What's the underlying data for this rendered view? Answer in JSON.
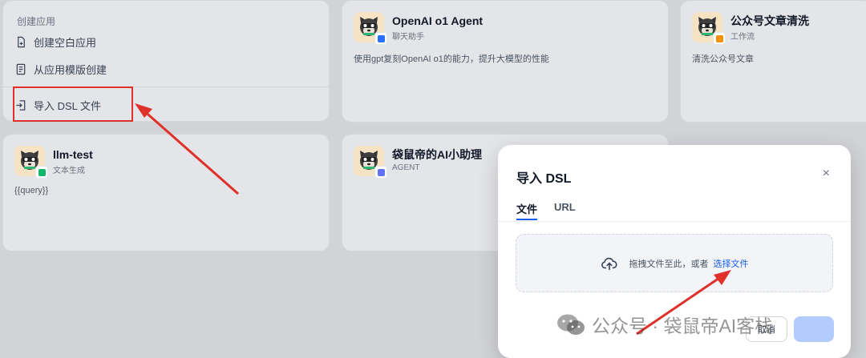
{
  "create_panel": {
    "title": "创建应用",
    "items": [
      {
        "label": "创建空白应用",
        "icon": "blank-file-icon"
      },
      {
        "label": "从应用模版创建",
        "icon": "template-icon"
      },
      {
        "label": "导入 DSL 文件",
        "icon": "import-icon"
      }
    ]
  },
  "apps": [
    {
      "name": "OpenAI o1 Agent",
      "type": "聊天助手",
      "desc": "使用gpt复刻OpenAI o1的能力，提升大模型的性能",
      "badge_color": "#2970ff"
    },
    {
      "name": "公众号文章清洗",
      "type": "工作流",
      "desc": "清洗公众号文章",
      "badge_color": "#f79009"
    },
    {
      "name": "llm-test",
      "type": "文本生成",
      "desc": "{{query}}",
      "badge_color": "#12b76a"
    },
    {
      "name": "袋鼠帝的AI小助理",
      "type": "AGENT",
      "desc": "",
      "badge_color": "#6172f3"
    }
  ],
  "modal": {
    "title": "导入 DSL",
    "close": "×",
    "tabs": [
      "文件",
      "URL"
    ],
    "drop_text": "拖拽文件至此，或者",
    "drop_link": "选择文件",
    "cancel": "取消"
  },
  "watermark": {
    "text": "公众号 · 袋鼠帝AI客栈"
  },
  "colors": {
    "accent": "#155eef",
    "annotation": "#e0302a"
  }
}
